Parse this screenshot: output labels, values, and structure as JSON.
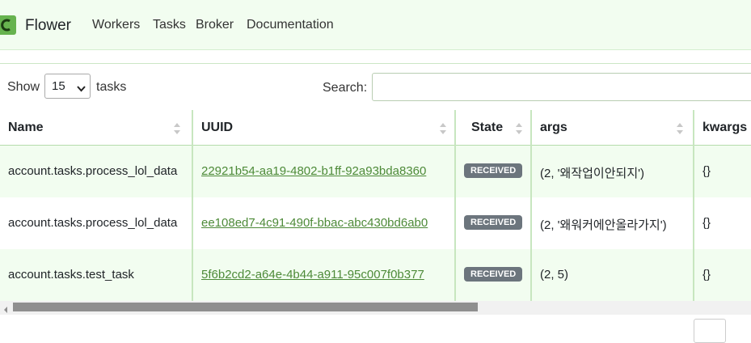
{
  "navbar": {
    "brand": "Flower",
    "links": [
      "Workers",
      "Tasks",
      "Broker",
      "Documentation"
    ]
  },
  "controls": {
    "show_label": "Show",
    "page_size": "15",
    "tasks_label": "tasks",
    "search_label": "Search:",
    "search_value": ""
  },
  "table": {
    "columns": [
      "Name",
      "UUID",
      "State",
      "args",
      "kwargs"
    ],
    "rows": [
      {
        "name": "account.tasks.process_lol_data",
        "uuid": "22921b54-aa19-4802-b1ff-92a93bda8360",
        "state": "RECEIVED",
        "args": "(2, '왜작업이안되지')",
        "kwargs": "{}"
      },
      {
        "name": "account.tasks.process_lol_data",
        "uuid": "ee108ed7-4c91-490f-bbac-abc430bd6ab0",
        "state": "RECEIVED",
        "args": "(2, '왜워커에안올라가지')",
        "kwargs": "{}"
      },
      {
        "name": "account.tasks.test_task",
        "uuid": "5f6b2cd2-a64e-4b44-a911-95c007f0b377",
        "state": "RECEIVED",
        "args": "(2, 5)",
        "kwargs": "{}"
      }
    ]
  },
  "colors": {
    "accent": "#4d8a38",
    "row_stripe": "#f2fdf0",
    "badge": "#6c757d"
  },
  "icons": {
    "logo": "celery-logo-icon",
    "sort": "sort-arrows-icon",
    "select": "chevron-down-icon"
  }
}
